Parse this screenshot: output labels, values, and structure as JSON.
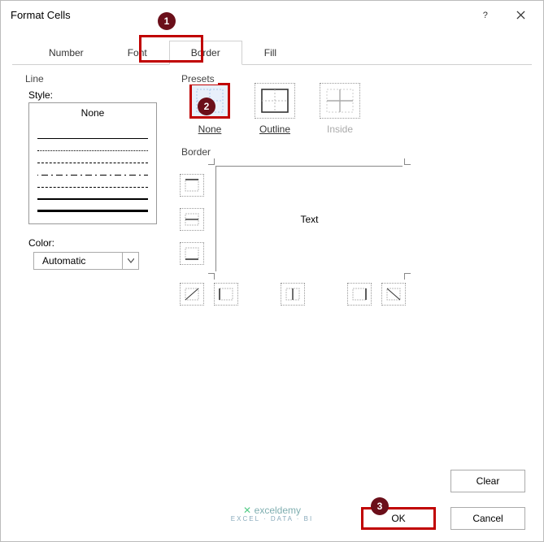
{
  "title": "Format Cells",
  "tabs": {
    "number": "Number",
    "font": "Font",
    "border": "Border",
    "fill": "Fill"
  },
  "line": {
    "group": "Line",
    "style_label": "Style:",
    "none": "None",
    "color_label": "Color:",
    "color_value": "Automatic"
  },
  "presets": {
    "group": "Presets",
    "none": "None",
    "outline": "Outline",
    "inside": "Inside"
  },
  "border": {
    "group": "Border",
    "preview_text": "Text"
  },
  "buttons": {
    "clear": "Clear",
    "ok": "OK",
    "cancel": "Cancel"
  },
  "logo": {
    "name": "exceldemy",
    "tagline": "EXCEL · DATA · BI"
  },
  "anno": {
    "one": "1",
    "two": "2",
    "three": "3"
  }
}
